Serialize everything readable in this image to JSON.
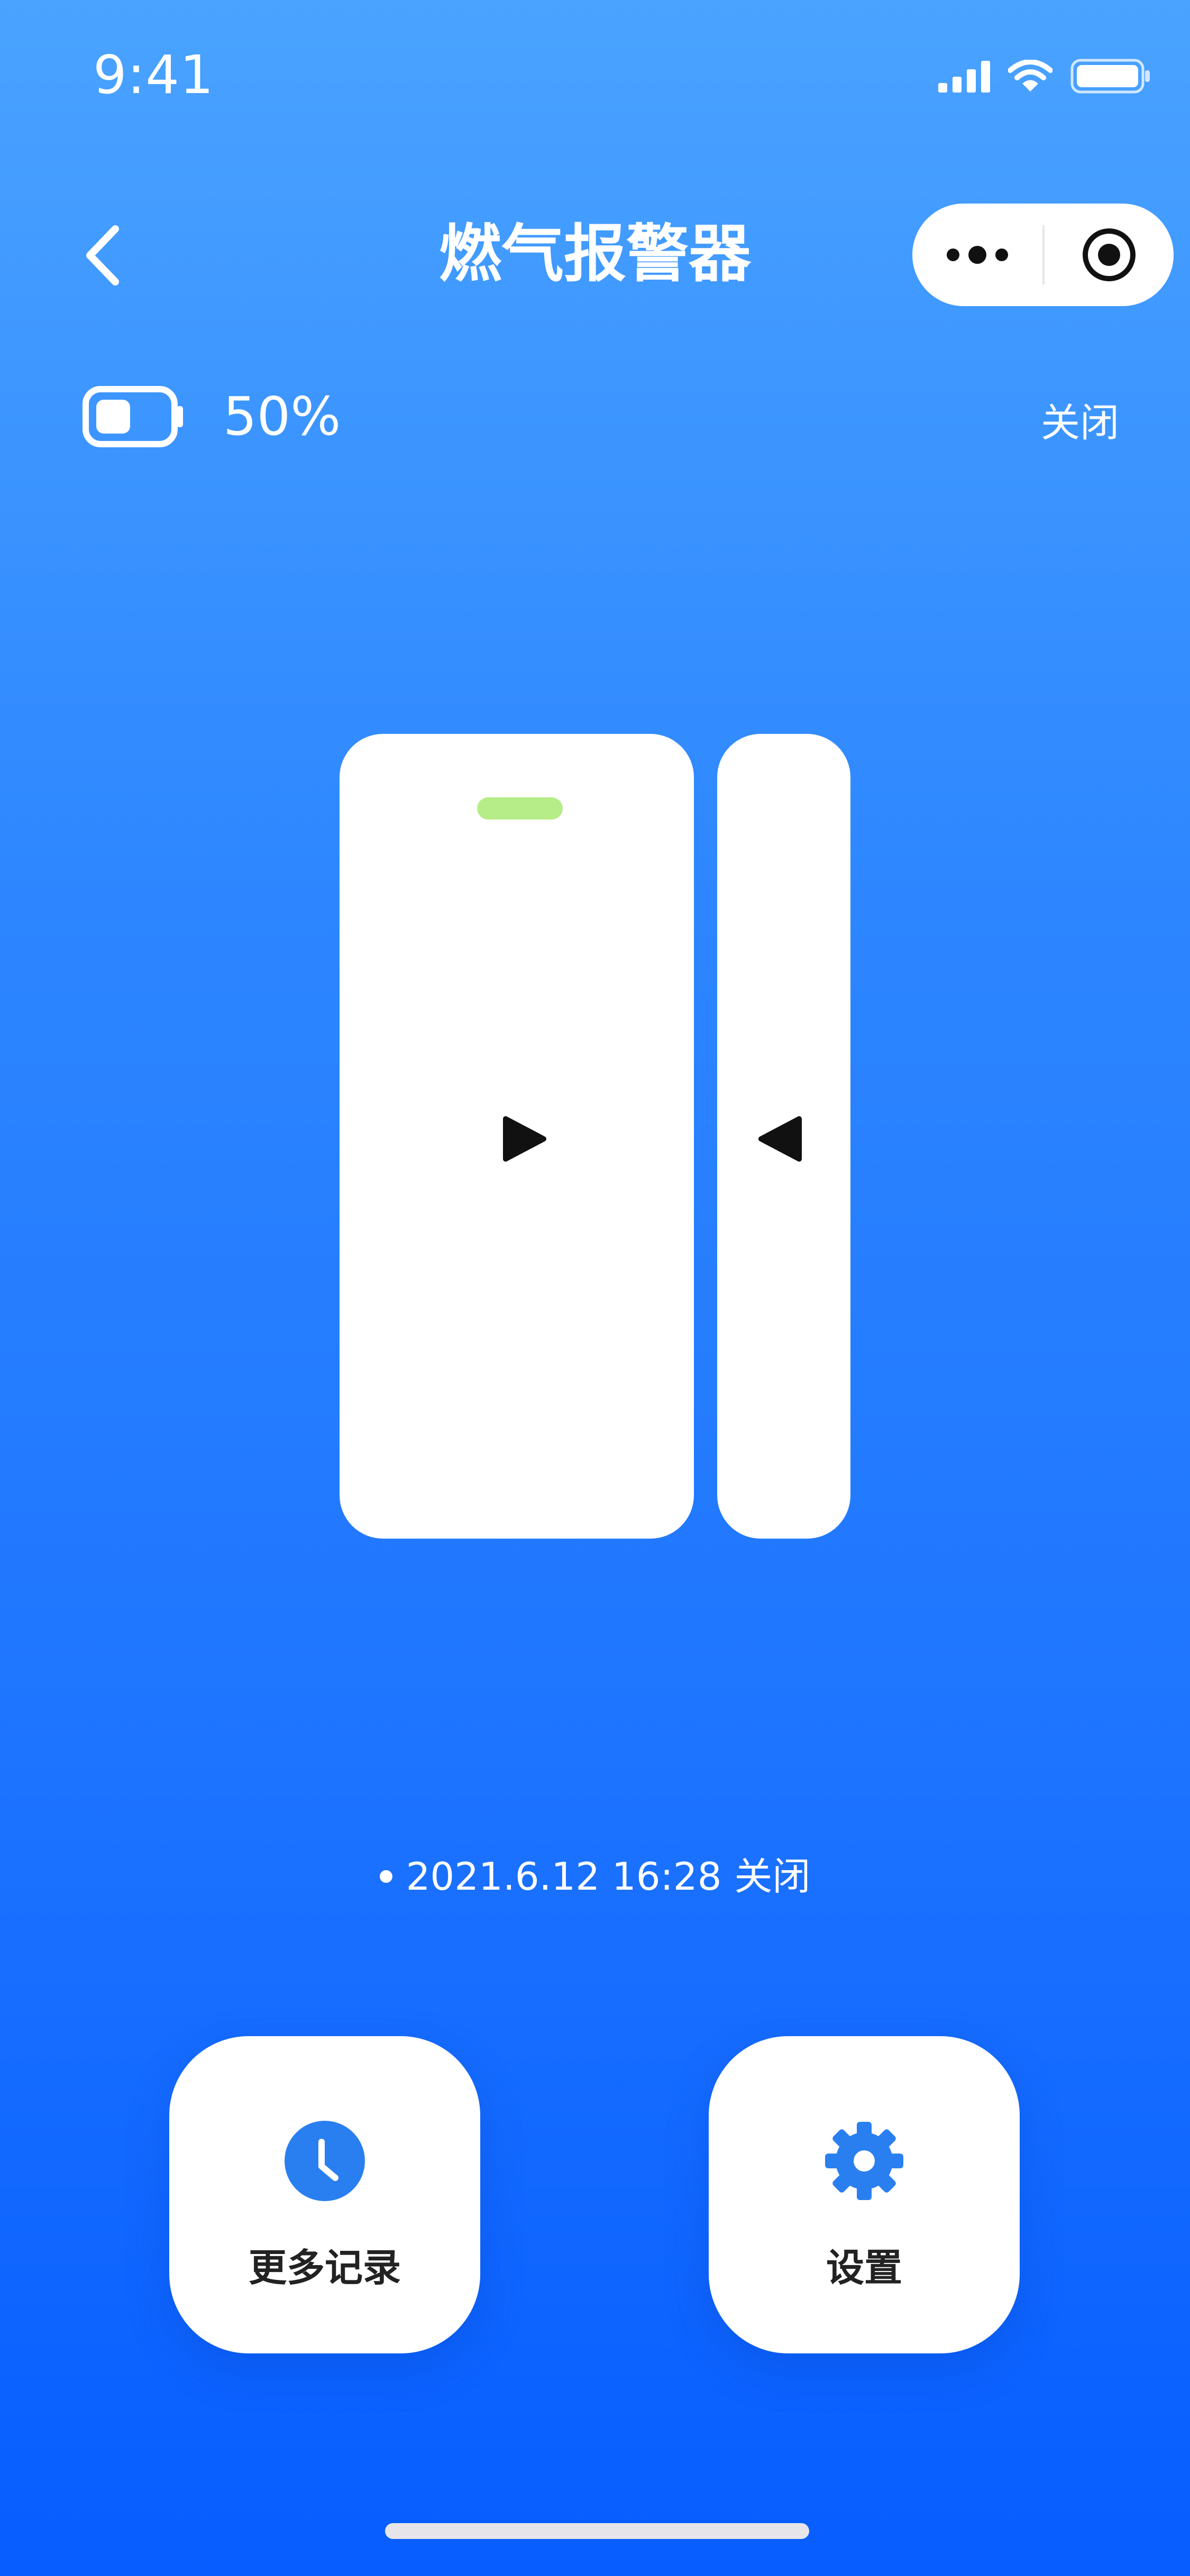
{
  "status_bar": {
    "time": "9:41",
    "icons": [
      "signal-icon",
      "wifi-icon",
      "battery-icon"
    ]
  },
  "nav": {
    "title": "燃气报警器",
    "back_icon": "chevron-left-icon",
    "capsule": {
      "more_icon": "more-dots-icon",
      "close_icon": "target-circle-icon"
    }
  },
  "device": {
    "battery_percent": "50%",
    "battery_level": 0.5,
    "state": "关闭"
  },
  "last_record": {
    "datetime": "2021.6.12 16:28",
    "status": "关闭"
  },
  "actions": [
    {
      "label": "更多记录",
      "icon": "clock-icon"
    },
    {
      "label": "设置",
      "icon": "gear-icon"
    }
  ],
  "colors": {
    "background_top": "#4aa3ff",
    "background_bottom": "#075dff",
    "accent": "#2a7ff0",
    "led": "#b6ed88"
  }
}
